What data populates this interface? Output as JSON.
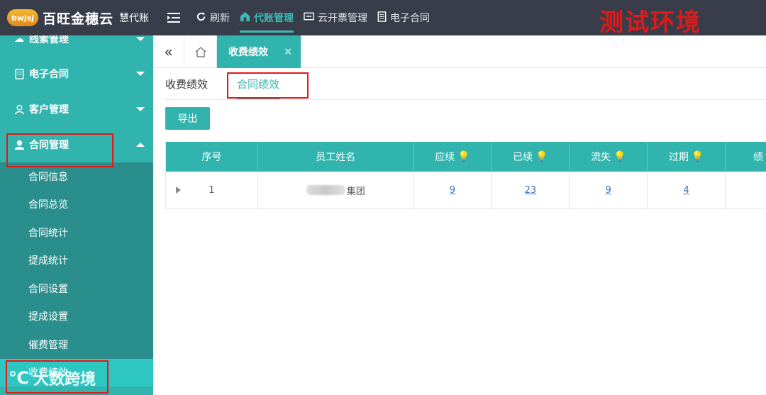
{
  "brand": {
    "logo_text": "bwjsj",
    "name": "百旺金穗云",
    "subname": "慧代账"
  },
  "topnav": {
    "items": [
      {
        "label": "刷新",
        "icon": "refresh-icon"
      },
      {
        "label": "代账管理",
        "icon": "home-icon",
        "active": true
      },
      {
        "label": "云开票管理",
        "icon": "ticket-icon"
      },
      {
        "label": "电子合同",
        "icon": "document-icon"
      }
    ]
  },
  "env_label": "测试环境",
  "sidebar": {
    "items": [
      {
        "label": "线索管理",
        "icon": "cloud-icon"
      },
      {
        "label": "电子合同",
        "icon": "document-icon"
      },
      {
        "label": "客户管理",
        "icon": "people-icon"
      },
      {
        "label": "合同管理",
        "icon": "person-icon"
      }
    ],
    "submenu": [
      "合同信息",
      "合同总览",
      "合同统计",
      "提成统计",
      "合同设置",
      "提成设置",
      "催费管理",
      "收费绩效"
    ]
  },
  "tabs": {
    "open_tab": "收费绩效",
    "close_symbol": "×"
  },
  "subtabs": [
    "收费绩效",
    "合同绩效"
  ],
  "toolbar": {
    "export_label": "导出"
  },
  "table": {
    "columns": [
      "序号",
      "员工姓名",
      "应续",
      "已续",
      "流失",
      "过期",
      "绩"
    ],
    "rows": [
      {
        "index": "1",
        "name_suffix": "集团",
        "due": "9",
        "renewed": "23",
        "lost": "9",
        "expired": "4"
      }
    ]
  },
  "watermark": "大数跨境"
}
